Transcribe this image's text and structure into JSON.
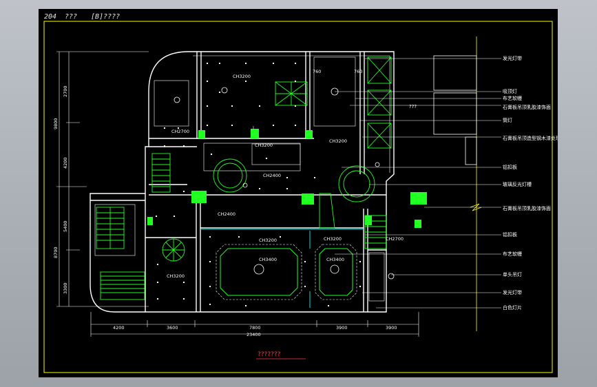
{
  "title_bar": {
    "prefix": "204",
    "t1": "???",
    "t2": "[B]????"
  },
  "caption": "???????",
  "center_note": "???",
  "ceiling_marks": [
    "CH3200",
    "CH2700",
    "CH3200",
    "CH3200",
    "CH2400",
    "CH2400",
    "CH3200",
    "CH3200",
    "CH3400",
    "CH3400",
    "CH2700",
    "CH3200",
    "760",
    "760"
  ],
  "legend": [
    "发光灯带",
    "吸顶灯",
    "布艺软幔",
    "石膏板吊顶乳胶漆饰面",
    "筒灯",
    "石膏板吊顶造型钢木漆处理",
    "铝扣板",
    "玻璃反光灯槽",
    "石膏板吊顶乳胶漆饰面",
    "铝扣板",
    "布艺软幔",
    "单头吊灯",
    "发光灯带",
    "白色灯片"
  ],
  "dims_bottom": [
    "4200",
    "3600",
    "7800",
    "3900",
    "3900"
  ],
  "dim_total": "23400",
  "dims_left_outer": [
    "9800",
    "8700"
  ],
  "dims_left_inner": [
    "2700",
    "4200",
    "5400",
    "3300"
  ],
  "colors": {
    "wall": "#ffffff",
    "green": "#22ff22",
    "yellow": "#ffff00",
    "cyan": "#00e0e0",
    "red": "#ff3b3b"
  }
}
